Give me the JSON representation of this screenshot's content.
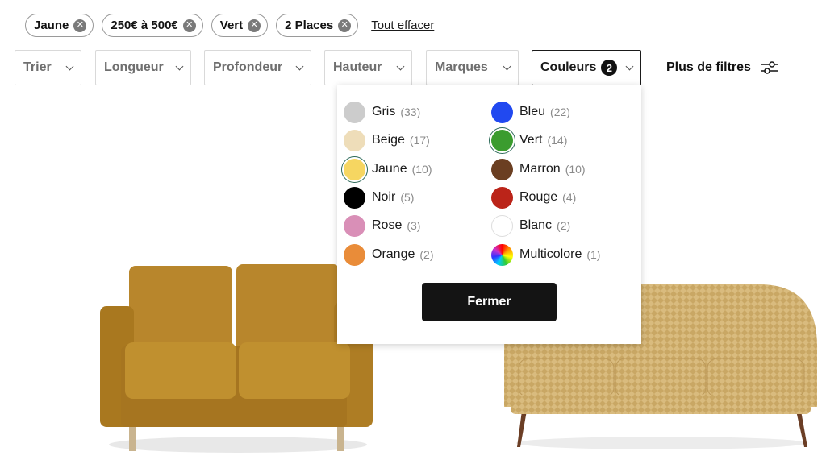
{
  "active_filters": [
    {
      "label": "Jaune"
    },
    {
      "label": "250€ à 500€"
    },
    {
      "label": "Vert"
    },
    {
      "label": "2 Places"
    }
  ],
  "clear_all": "Tout effacer",
  "filters": {
    "sort": "Trier",
    "length": "Longueur",
    "depth": "Profondeur",
    "height": "Hauteur",
    "brands": "Marques",
    "colors": "Couleurs",
    "colors_count": "2",
    "more": "Plus de filtres"
  },
  "colors": [
    {
      "name": "Gris",
      "count": "(33)",
      "hex": "#cccccc",
      "selected": false
    },
    {
      "name": "Bleu",
      "count": "(22)",
      "hex": "#2149f0",
      "selected": false
    },
    {
      "name": "Beige",
      "count": "(17)",
      "hex": "#eeddb9",
      "selected": false
    },
    {
      "name": "Vert",
      "count": "(14)",
      "hex": "#3b9c2f",
      "selected": true
    },
    {
      "name": "Jaune",
      "count": "(10)",
      "hex": "#f6d661",
      "selected": true
    },
    {
      "name": "Marron",
      "count": "(10)",
      "hex": "#6b3f22",
      "selected": false
    },
    {
      "name": "Noir",
      "count": "(5)",
      "hex": "#000000",
      "selected": false
    },
    {
      "name": "Rouge",
      "count": "(4)",
      "hex": "#bb2419",
      "selected": false
    },
    {
      "name": "Rose",
      "count": "(3)",
      "hex": "#d98fb7",
      "selected": false
    },
    {
      "name": "Blanc",
      "count": "(2)",
      "hex": "#ffffff",
      "selected": false
    },
    {
      "name": "Orange",
      "count": "(2)",
      "hex": "#e98c39",
      "selected": false
    },
    {
      "name": "Multicolore",
      "count": "(1)",
      "hex": "multicolor",
      "selected": false
    }
  ],
  "close_label": "Fermer"
}
